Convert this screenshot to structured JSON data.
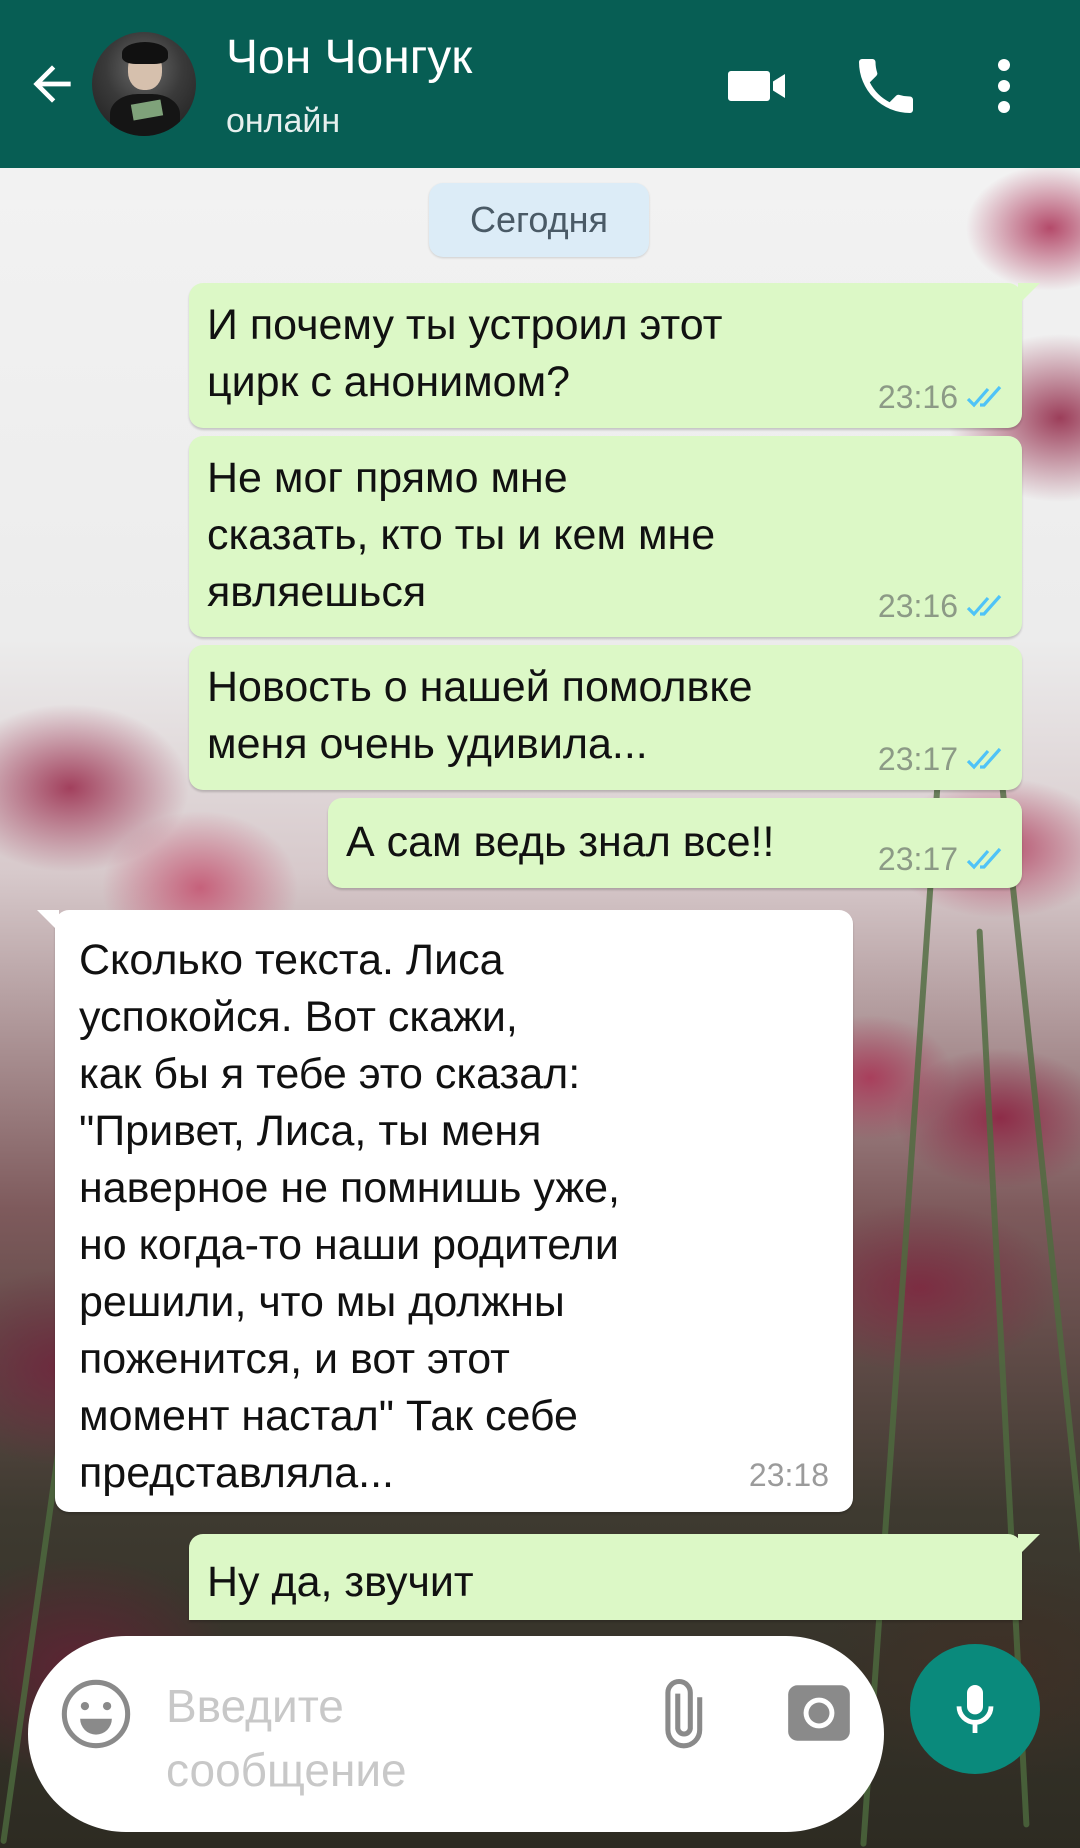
{
  "header": {
    "contact_name": "Чон Чонгук",
    "status": "онлайн",
    "icons": [
      "back-arrow-icon",
      "videocam-icon",
      "phone-icon",
      "more-vert-icon"
    ]
  },
  "date_chip": "Сегодня",
  "messages": [
    {
      "direction": "out",
      "text": "И почему ты устроил этот\nцирк с анонимом?",
      "time": "23:16",
      "read": true
    },
    {
      "direction": "out",
      "text": "Не мог прямо мне\nсказать, кто ты и кем мне\nявляешься",
      "time": "23:16",
      "read": true
    },
    {
      "direction": "out",
      "text": "Новость о нашей помолвке\nменя очень удивила...",
      "time": "23:17",
      "read": true
    },
    {
      "direction": "out",
      "text": "А сам ведь знал все!!",
      "time": "23:17",
      "read": true
    },
    {
      "direction": "in",
      "text": "Сколько текста. Лиса\nуспокойся. Вот скажи,\nкак бы я тебе это сказал:\n\"Привет, Лиса, ты меня\nнаверное не помнишь уже,\nно когда-то наши родители\nрешили, что мы должны\nпоженится, и вот этот\nмомент настал\" Так себе\nпредставляла...",
      "time": "23:18"
    },
    {
      "direction": "out",
      "text": "Ну да, звучит",
      "time": "",
      "partial": true
    }
  ],
  "composer": {
    "placeholder": "Введите\nсообщение",
    "icons": [
      "emoji-icon",
      "attach-icon",
      "camera-icon",
      "mic-icon"
    ]
  },
  "colors": {
    "app_bar": "#075e54",
    "outgoing_bubble": "#dcf8c6",
    "incoming_bubble": "#ffffff",
    "read_ticks": "#4fc3f7",
    "mic_button": "#0a8a7c"
  }
}
